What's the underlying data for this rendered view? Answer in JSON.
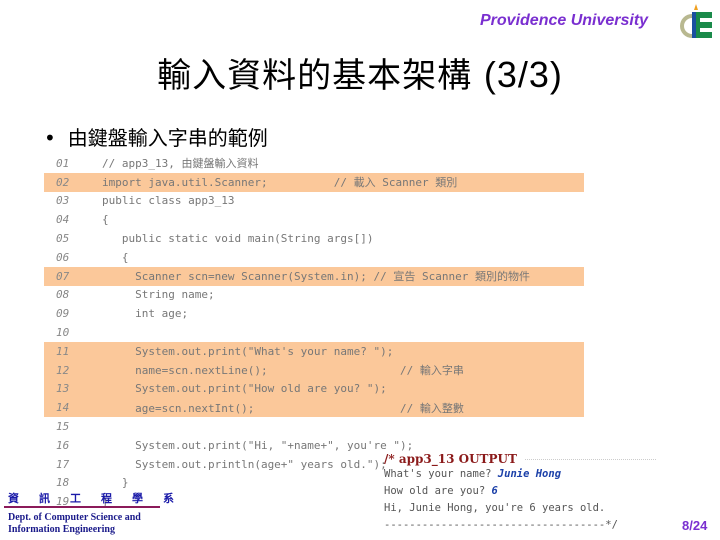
{
  "header": {
    "university": "Providence University",
    "logo_icon": "department-logo-icon"
  },
  "slide": {
    "title": "輸入資料的基本架構",
    "title_suffix": "(3/3)",
    "bullet": "由鍵盤輸入字串的範例"
  },
  "code": {
    "lines": [
      {
        "num": "01",
        "text": "// app3_13, 由鍵盤輸入資料",
        "highlight": false
      },
      {
        "num": "02",
        "text": "import java.util.Scanner;          // 載入 Scanner 類別",
        "highlight": true
      },
      {
        "num": "03",
        "text": "public class app3_13",
        "highlight": false
      },
      {
        "num": "04",
        "text": "{",
        "highlight": false
      },
      {
        "num": "05",
        "text": "   public static void main(String args[])",
        "highlight": false
      },
      {
        "num": "06",
        "text": "   {",
        "highlight": false
      },
      {
        "num": "07",
        "text": "     Scanner scn=new Scanner(System.in); // 宣告 Scanner 類別的物件",
        "highlight": true
      },
      {
        "num": "08",
        "text": "     String name;",
        "highlight": false
      },
      {
        "num": "09",
        "text": "     int age;",
        "highlight": false
      },
      {
        "num": "10",
        "text": "",
        "highlight": false
      },
      {
        "num": "11",
        "text": "     System.out.print(\"What's your name? \");",
        "highlight": true
      },
      {
        "num": "12",
        "text": "     name=scn.nextLine();                    // 輸入字串",
        "highlight": true
      },
      {
        "num": "13",
        "text": "     System.out.print(\"How old are you? \");",
        "highlight": true
      },
      {
        "num": "14",
        "text": "     age=scn.nextInt();                      // 輸入整數",
        "highlight": true
      },
      {
        "num": "15",
        "text": "",
        "highlight": false
      },
      {
        "num": "16",
        "text": "     System.out.print(\"Hi, \"+name+\", you're \");",
        "highlight": false
      },
      {
        "num": "17",
        "text": "     System.out.println(age+\" years old.\");",
        "highlight": false
      },
      {
        "num": "18",
        "text": "   }",
        "highlight": false
      },
      {
        "num": "19",
        "text": "}",
        "highlight": false
      }
    ]
  },
  "output": {
    "title": "/* app3_13  OUTPUT",
    "line1_prompt": "What's your name? ",
    "line1_input": "Junie Hong",
    "line2_prompt": "How old are you? ",
    "line2_input": "6",
    "line3": "Hi, Junie Hong, you're 6 years old.",
    "end": "-----------------------------------*/"
  },
  "footer": {
    "dept_cn": "資訊工程學系",
    "dept_en_1": "Dept. of Computer Science and",
    "dept_en_2": "Information Engineering",
    "page": "8/24"
  },
  "colors": {
    "highlight": "#fbc89a",
    "brand_purple": "#7a2fd0",
    "output_title": "#8b1a1a",
    "output_input": "#1a3fa8"
  }
}
